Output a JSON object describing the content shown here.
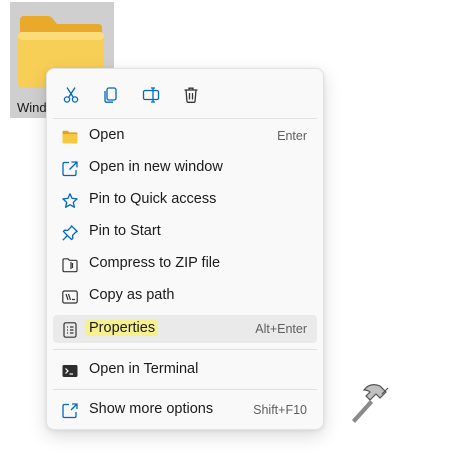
{
  "folder": {
    "name": "Windo"
  },
  "toolbar": {
    "buttons": [
      {
        "icon": "cut-icon"
      },
      {
        "icon": "copy-icon"
      },
      {
        "icon": "rename-icon"
      },
      {
        "icon": "delete-icon"
      }
    ]
  },
  "menu": {
    "items": [
      {
        "label": "Open",
        "shortcut": "Enter",
        "icon": "folder-icon"
      },
      {
        "label": "Open in new window",
        "shortcut": "",
        "icon": "open-new-window-icon"
      },
      {
        "label": "Pin to Quick access",
        "shortcut": "",
        "icon": "star-icon"
      },
      {
        "label": "Pin to Start",
        "shortcut": "",
        "icon": "pin-icon"
      },
      {
        "label": "Compress to ZIP file",
        "shortcut": "",
        "icon": "zip-icon"
      },
      {
        "label": "Copy as path",
        "shortcut": "",
        "icon": "copy-path-icon"
      },
      {
        "label": "Properties",
        "shortcut": "Alt+Enter",
        "icon": "properties-icon"
      },
      {
        "label": "Open in Terminal",
        "shortcut": "",
        "icon": "terminal-icon"
      },
      {
        "label": "Show more options",
        "shortcut": "Shift+F10",
        "icon": "more-options-icon"
      }
    ]
  },
  "colors": {
    "accent": "#0067c0",
    "folder_yellow": "#f5c84a",
    "highlight": "#f7f08e"
  }
}
